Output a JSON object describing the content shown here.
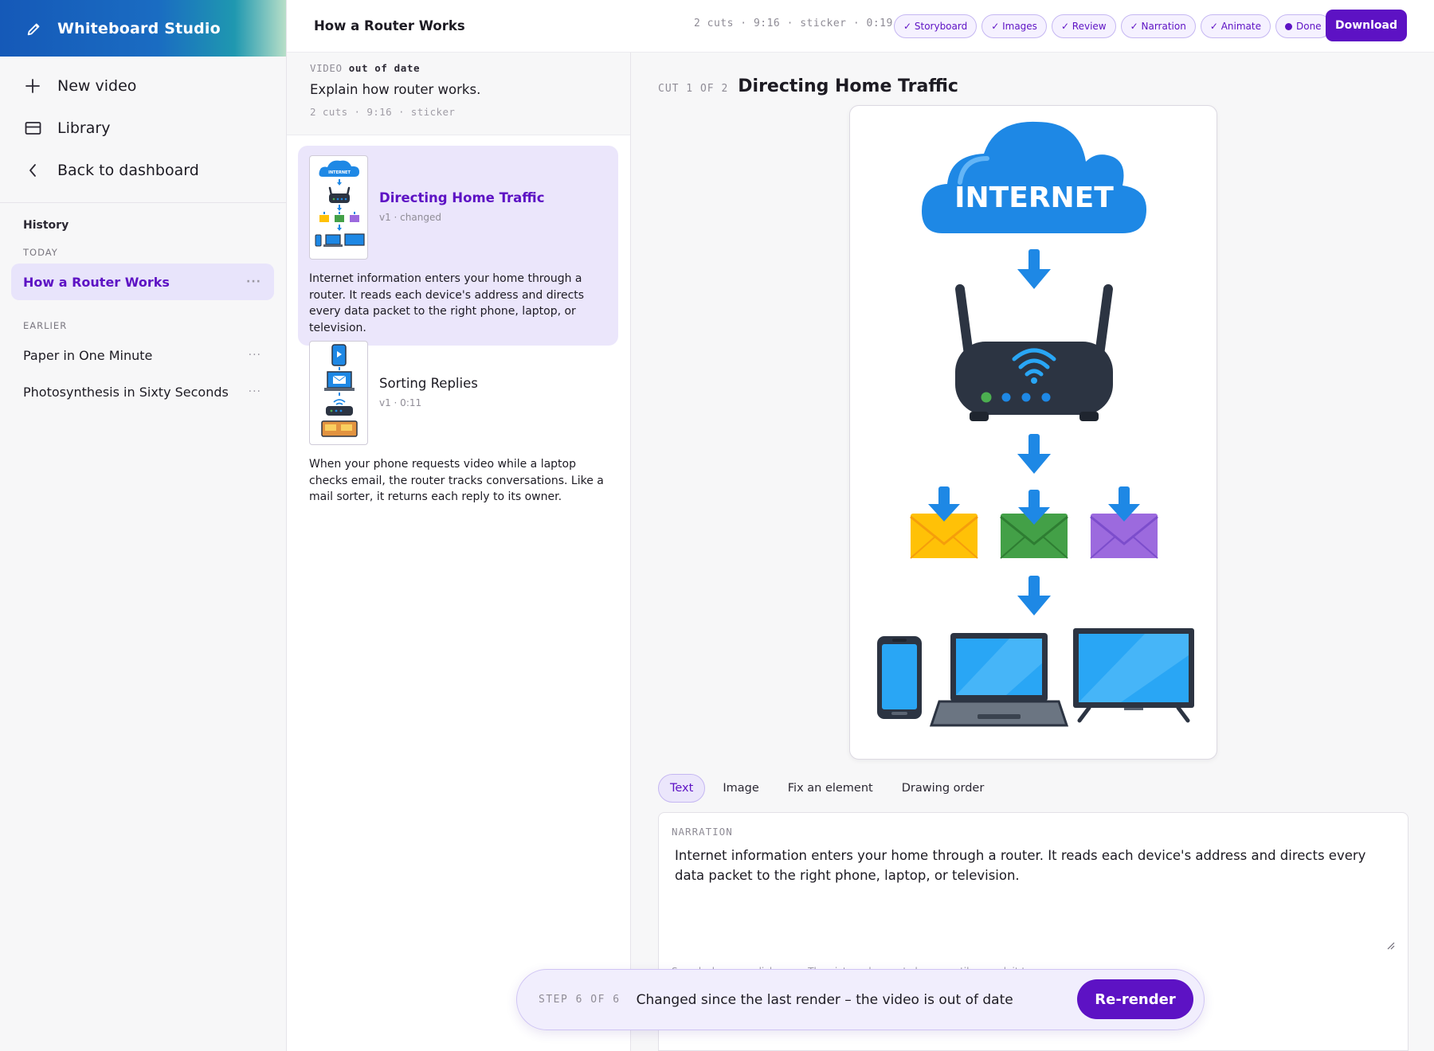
{
  "app": {
    "name": "Whiteboard Studio",
    "brand_icon": "pencil-icon"
  },
  "nav": [
    {
      "label": "New video",
      "icon": "plus-icon"
    },
    {
      "label": "Library",
      "icon": "library-icon"
    },
    {
      "label": "Back to dashboard",
      "icon": "chevron-left-icon"
    }
  ],
  "history": {
    "title": "History",
    "today_label": "TODAY",
    "today": [
      {
        "label": "How a Router Works"
      }
    ],
    "earlier_label": "EARLIER",
    "earlier": [
      {
        "label": "Paper in One Minute"
      },
      {
        "label": "Photosynthesis in Sixty Seconds"
      }
    ]
  },
  "header": {
    "title": "How a Router Works",
    "meta": "2 cuts · 9:16 · sticker · 0:19",
    "steps": [
      "✓ Storyboard",
      "✓ Images",
      "✓ Review",
      "✓ Narration",
      "✓ Animate",
      "Done"
    ],
    "download_label": "Download"
  },
  "video": {
    "status_prefix": "VIDEO",
    "status": "out of date",
    "prompt": "Explain how router works.",
    "meta": "2 cuts · 9:16 · sticker"
  },
  "cuts": [
    {
      "title": "Directing Home Traffic",
      "sub": "v1 · changed",
      "text": "Internet information enters your home through a router. It reads each device's address and directs every data packet to the right phone, laptop, or television."
    },
    {
      "title": "Sorting Replies",
      "sub": "v1 · 0:11",
      "text": "When your phone requests video while a laptop checks email, the router tracks conversations. Like a mail sorter, it returns each reply to its owner."
    }
  ],
  "editor": {
    "cut_label": "CUT 1 OF 2",
    "cut_title": "Directing Home Traffic",
    "illustration_text": "INTERNET",
    "tabs": [
      "Text",
      "Image",
      "Fix an element",
      "Drawing order"
    ],
    "narration_label": "NARRATION",
    "narration": "Internet information enters your home through a router. It reads each device's address and directs every data packet to the right phone, laptop, or television.",
    "help": "Saved when you click away. The picture does not change until you ask it to."
  },
  "toast": {
    "step": "STEP 6 OF 6",
    "message": "Changed since the last render – the video is out of date",
    "button": "Re-render"
  },
  "colors": {
    "accent": "#5d12c4",
    "accent_soft": "#ebe6fb",
    "blue": "#1e88e5"
  }
}
